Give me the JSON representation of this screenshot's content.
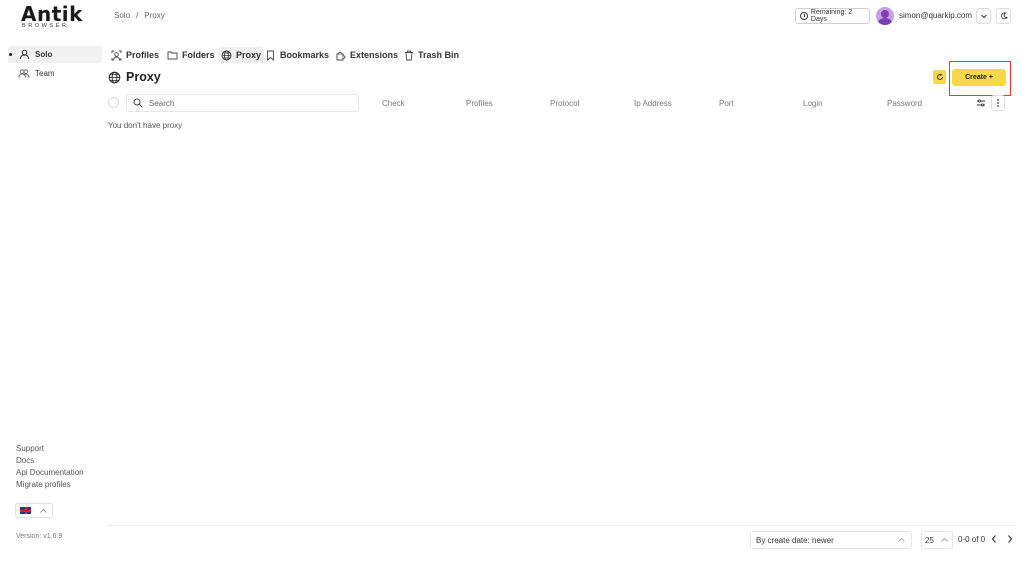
{
  "logo": {
    "word": "Antik",
    "sub": "BROWSER"
  },
  "breadcrumb": {
    "items": [
      "Solo",
      "/",
      "Proxy"
    ]
  },
  "header": {
    "remaining": "Remaining: 2 Days",
    "email": "simon@quarkip.com"
  },
  "sidebar": {
    "items": [
      {
        "label": "Solo",
        "active": true,
        "icon": "user-icon"
      },
      {
        "label": "Team",
        "active": false,
        "icon": "users-icon"
      }
    ],
    "footer_links": [
      "Support",
      "Docs",
      "Api Documentation",
      "Migrate profiles"
    ],
    "language_flag": "uk-flag-icon",
    "version": "Version: v1.6.9"
  },
  "tabs": [
    {
      "label": "Profiles",
      "icon": "profiles-icon"
    },
    {
      "label": "Folders",
      "icon": "folder-icon"
    },
    {
      "label": "Proxy",
      "icon": "globe-icon",
      "active": true
    },
    {
      "label": "Bookmarks",
      "icon": "bookmark-icon"
    },
    {
      "label": "Extensions",
      "icon": "puzzle-icon"
    },
    {
      "label": "Trash Bin",
      "icon": "trash-icon"
    }
  ],
  "page": {
    "title": "Proxy",
    "empty_message": "You don't have proxy"
  },
  "actions": {
    "create_label": "Create +"
  },
  "table": {
    "search_placeholder": "Search",
    "columns": [
      "Check",
      "Profiles",
      "Protocol",
      "Ip Address",
      "Port",
      "Login",
      "Password"
    ]
  },
  "footer": {
    "sort_value": "By create date: newer",
    "per_page": "25",
    "range": "0-0 of 0"
  },
  "colors": {
    "accent": "#f6d94a",
    "highlight": "#e53935"
  }
}
